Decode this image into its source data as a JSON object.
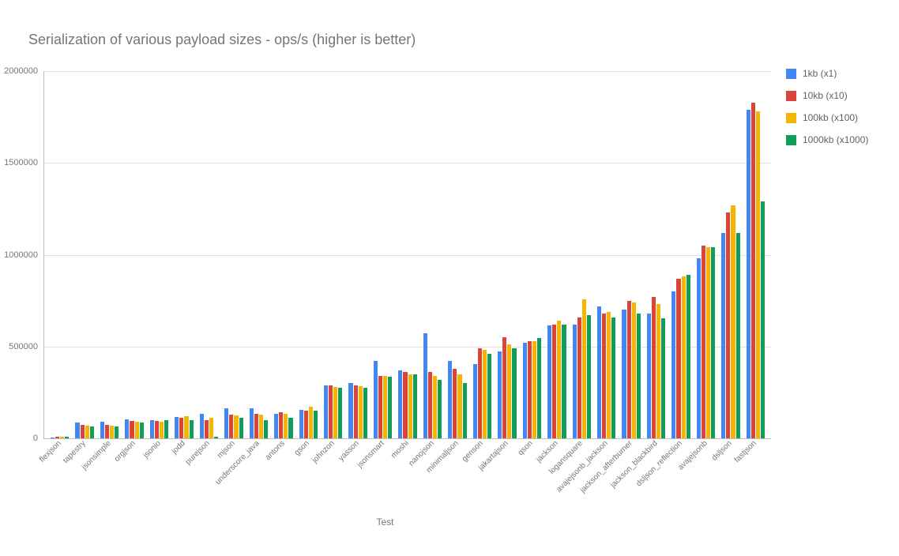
{
  "title": "Serialization of various payload sizes  - ops/s (higher is better)",
  "xlabel": "Test",
  "legend": [
    {
      "name": "1kb (x1)",
      "color": "#4285F4"
    },
    {
      "name": "10kb (x10)",
      "color": "#DB4437"
    },
    {
      "name": "100kb (x100)",
      "color": "#F4B400"
    },
    {
      "name": "1000kb (x1000)",
      "color": "#0F9D58"
    }
  ],
  "chart_data": {
    "type": "bar",
    "title": "Serialization of various payload sizes  - ops/s (higher is better)",
    "xlabel": "Test",
    "ylabel": "",
    "ylim": [
      0,
      2000000
    ],
    "yticks": [
      0,
      500000,
      1000000,
      1500000,
      2000000
    ],
    "categories": [
      "flexjson",
      "tapestry",
      "jsonsimple",
      "orgjson",
      "jsonio",
      "jodd",
      "purejson",
      "mjson",
      "underscore_java",
      "antons",
      "gson",
      "johnzon",
      "yasson",
      "jsonsmart",
      "moshi",
      "nanojson",
      "minimaljson",
      "genson",
      "jakartajson",
      "qson",
      "jackson",
      "logansquare",
      "avajejsonb_jackson",
      "jackson_afterburner",
      "jackson_blackbird",
      "dsljson_reflection",
      "avajejsonb",
      "dsljson",
      "fastjson"
    ],
    "series": [
      {
        "name": "1kb (x1)",
        "color": "#4285F4",
        "values": [
          5000,
          85000,
          90000,
          105000,
          98000,
          115000,
          135000,
          165000,
          165000,
          135000,
          155000,
          290000,
          300000,
          420000,
          370000,
          570000,
          420000,
          405000,
          475000,
          520000,
          615000,
          620000,
          720000,
          700000,
          680000,
          800000,
          980000,
          1120000,
          1790000
        ]
      },
      {
        "name": "10kb (x10)",
        "color": "#DB4437",
        "values": [
          7000,
          75000,
          72000,
          95000,
          95000,
          110000,
          100000,
          130000,
          135000,
          140000,
          150000,
          290000,
          290000,
          340000,
          360000,
          360000,
          380000,
          490000,
          550000,
          530000,
          620000,
          660000,
          680000,
          750000,
          770000,
          870000,
          1050000,
          1230000,
          1830000
        ]
      },
      {
        "name": "100kb (x100)",
        "color": "#F4B400",
        "values": [
          8000,
          70000,
          68000,
          90000,
          90000,
          120000,
          110000,
          125000,
          130000,
          135000,
          170000,
          280000,
          285000,
          340000,
          350000,
          340000,
          350000,
          480000,
          510000,
          530000,
          640000,
          755000,
          690000,
          740000,
          730000,
          880000,
          1040000,
          1270000,
          1780000
        ]
      },
      {
        "name": "1000kb (x1000)",
        "color": "#0F9D58",
        "values": [
          10000,
          65000,
          65000,
          85000,
          100000,
          100000,
          10000,
          110000,
          100000,
          110000,
          150000,
          275000,
          275000,
          335000,
          350000,
          320000,
          300000,
          460000,
          490000,
          545000,
          620000,
          670000,
          660000,
          680000,
          655000,
          890000,
          1040000,
          1120000,
          1290000
        ]
      }
    ]
  }
}
